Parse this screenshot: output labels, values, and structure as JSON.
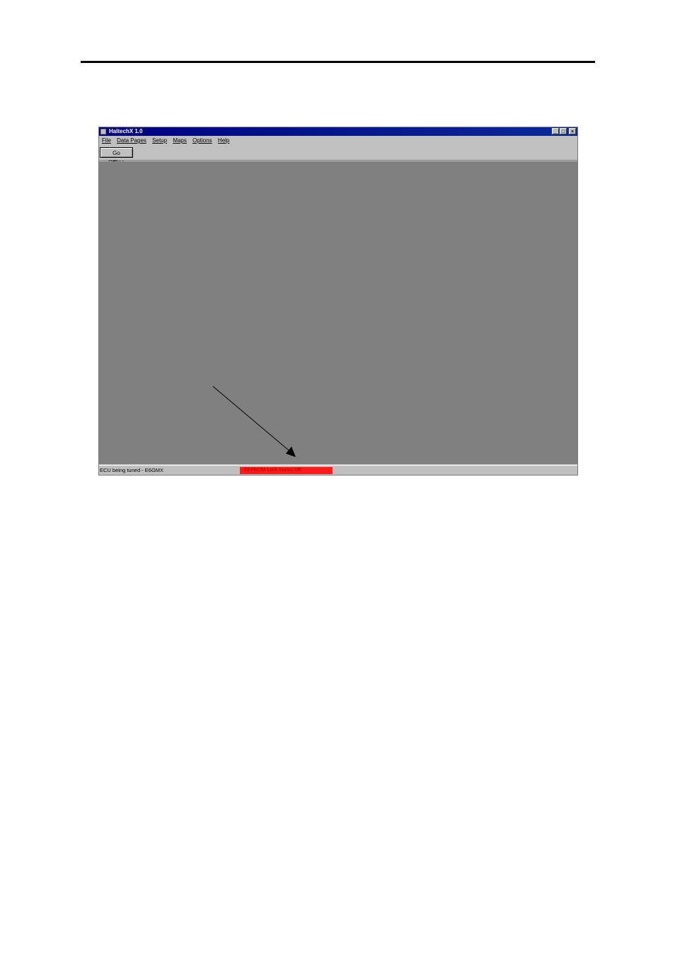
{
  "window": {
    "title": "HaltechX 1.0",
    "controls": {
      "minimize": "_",
      "maximize": "□",
      "close": "×"
    }
  },
  "menu": {
    "items": [
      "File",
      "Data Pages",
      "Setup",
      "Maps",
      "Options",
      "Help"
    ]
  },
  "toolbar": {
    "go_offline_label": "Go Offline"
  },
  "statusbar": {
    "ecu_text": "ECU being tuned - E6GMX",
    "red_indicator_text": "EEPROM Lock Status Off"
  },
  "colors": {
    "title_bar": "#000080",
    "workspace": "#808080",
    "status_indicator": "#ff1a1a"
  }
}
